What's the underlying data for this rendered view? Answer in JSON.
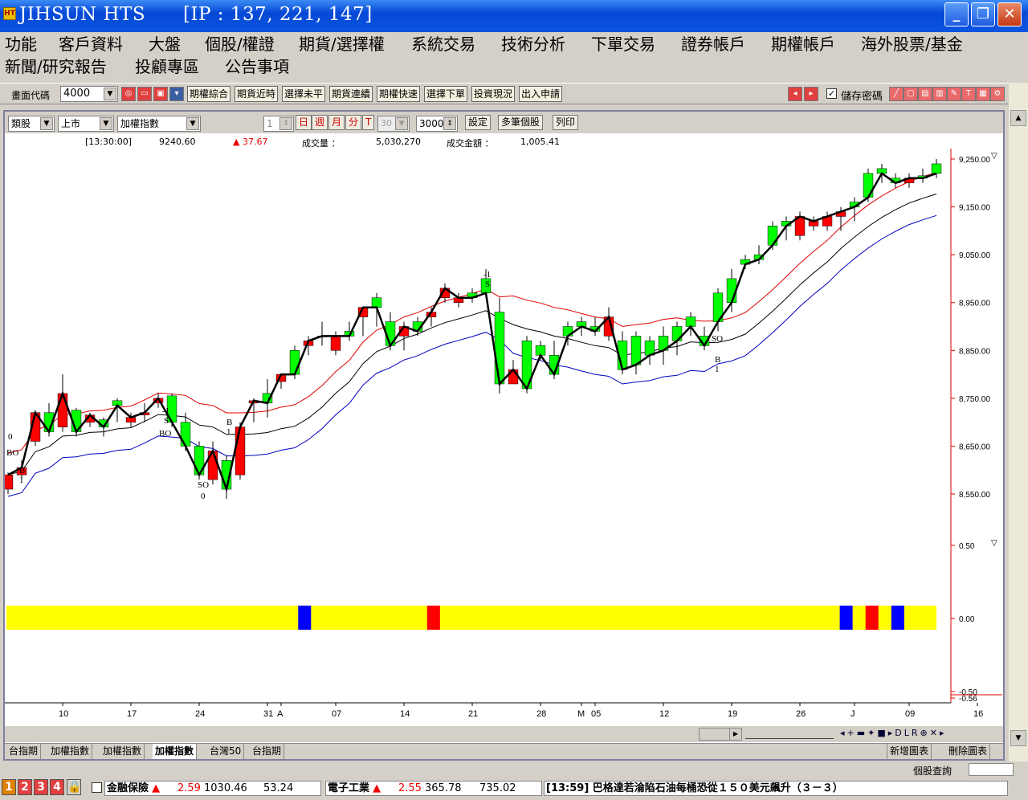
{
  "window": {
    "title": "JIHSUN HTS      [IP : 137, 221, 147]",
    "icon_text": "HT",
    "min": "_",
    "max": "❐",
    "close": "✕"
  },
  "menu": {
    "row1": [
      "功能",
      "客戶資料",
      "大盤",
      "個股/權證",
      "期貨/選擇權",
      "系統交易",
      "技術分析",
      "下單交易",
      "證券帳戶",
      "期權帳戶",
      "海外股票/基金"
    ],
    "row2": [
      "新聞/研究報告",
      "投顧專區",
      "公告事項"
    ]
  },
  "toolbar": {
    "code_label": "畫面代碼",
    "code_value": "4000",
    "funcs": [
      "期權綜合",
      "期貨近時",
      "選擇未平",
      "期貨連續",
      "期權快速",
      "選擇下單",
      "投資現況",
      "出入申請"
    ],
    "save_pwd": "儲存密碼"
  },
  "chart_toolbar": {
    "category": "類股",
    "market": "上市",
    "index": "加權指數",
    "n1": "1",
    "periods": [
      "日",
      "週",
      "月",
      "分",
      "T"
    ],
    "n2": "30",
    "count": "30000",
    "buttons": [
      "設定",
      "多筆個股",
      "列印"
    ]
  },
  "info": {
    "time": "[13:30:00]",
    "price": "9240.60",
    "change": "▲ 37.67",
    "vol_label": "成交量 ：",
    "vol": "5,030,270",
    "amt_label": "成交金額 ：",
    "amt": "1,005.41"
  },
  "chart_data": {
    "type": "candlestick",
    "ylim": [
      8500,
      9260
    ],
    "y_ticks": [
      "9,250.00",
      "9,150.00",
      "9,050.00",
      "8,950.00",
      "8,850.00",
      "8,750.00",
      "8,650.00",
      "8,550.00"
    ],
    "y_tick_values": [
      9250,
      9150,
      9050,
      8950,
      8850,
      8750,
      8650,
      8550
    ],
    "x_ticks": [
      "10",
      "17",
      "24",
      "31",
      "A",
      "07",
      "14",
      "21",
      "28",
      "M",
      "05",
      "12",
      "19",
      "26",
      "J",
      "09",
      "16"
    ],
    "x_tick_index": [
      4,
      9,
      14,
      19,
      20,
      24,
      29,
      34,
      39,
      42,
      43,
      48,
      53,
      58,
      62,
      66,
      71
    ],
    "candles": [
      [
        8560,
        8590,
        8550,
        8595
      ],
      [
        8590,
        8605,
        8580,
        8620
      ],
      [
        8660,
        8720,
        8650,
        8725
      ],
      [
        8720,
        8680,
        8670,
        8740
      ],
      [
        8690,
        8760,
        8680,
        8800
      ],
      [
        8725,
        8680,
        8670,
        8730
      ],
      [
        8700,
        8715,
        8690,
        8720
      ],
      [
        8705,
        8690,
        8670,
        8710
      ],
      [
        8745,
        8735,
        8700,
        8750
      ],
      [
        8700,
        8710,
        8690,
        8720
      ],
      [
        8715,
        8720,
        8700,
        8740
      ],
      [
        8740,
        8750,
        8730,
        8760
      ],
      [
        8755,
        8700,
        8690,
        8760
      ],
      [
        8700,
        8650,
        8640,
        8720
      ],
      [
        8650,
        8590,
        8580,
        8660
      ],
      [
        8580,
        8640,
        8570,
        8660
      ],
      [
        8620,
        8560,
        8540,
        8630
      ],
      [
        8590,
        8690,
        8580,
        8700
      ],
      [
        8740,
        8745,
        8700,
        8750
      ],
      [
        8760,
        8740,
        8710,
        8790
      ],
      [
        8785,
        8800,
        8770,
        8800
      ],
      [
        8850,
        8800,
        8790,
        8860
      ],
      [
        8860,
        8870,
        8840,
        8880
      ],
      [
        8880,
        8880,
        8860,
        8910
      ],
      [
        8850,
        8880,
        8840,
        8890
      ],
      [
        8890,
        8880,
        8870,
        8910
      ],
      [
        8920,
        8940,
        8880,
        8940
      ],
      [
        8960,
        8940,
        8900,
        8970
      ],
      [
        8910,
        8860,
        8850,
        8930
      ],
      [
        8880,
        8900,
        8850,
        8910
      ],
      [
        8910,
        8890,
        8880,
        8920
      ],
      [
        8920,
        8930,
        8900,
        8940
      ],
      [
        8960,
        8980,
        8950,
        8990
      ],
      [
        8950,
        8960,
        8940,
        8970
      ],
      [
        8970,
        8960,
        8950,
        8980
      ],
      [
        9000,
        8970,
        8960,
        9020
      ],
      [
        8930,
        8780,
        8760,
        8960
      ],
      [
        8780,
        8810,
        8790,
        8830
      ],
      [
        8870,
        8770,
        8760,
        8880
      ],
      [
        8860,
        8840,
        8830,
        8870
      ],
      [
        8840,
        8800,
        8790,
        8870
      ],
      [
        8900,
        8880,
        8860,
        8910
      ],
      [
        8910,
        8900,
        8880,
        8920
      ],
      [
        8900,
        8890,
        8880,
        8920
      ],
      [
        8880,
        8920,
        8870,
        8940
      ],
      [
        8870,
        8810,
        8800,
        8890
      ],
      [
        8880,
        8820,
        8800,
        8890
      ],
      [
        8870,
        8840,
        8820,
        8880
      ],
      [
        8880,
        8850,
        8820,
        8900
      ],
      [
        8900,
        8870,
        8840,
        8910
      ],
      [
        8920,
        8900,
        8880,
        8930
      ],
      [
        8880,
        8860,
        8850,
        8900
      ],
      [
        8970,
        8910,
        8890,
        8980
      ],
      [
        9000,
        8950,
        8930,
        9020
      ],
      [
        9040,
        9030,
        9020,
        9050
      ],
      [
        9050,
        9040,
        9030,
        9070
      ],
      [
        9110,
        9070,
        9060,
        9120
      ],
      [
        9120,
        9110,
        9080,
        9130
      ],
      [
        9090,
        9130,
        9080,
        9140
      ],
      [
        9110,
        9120,
        9100,
        9130
      ],
      [
        9110,
        9130,
        9100,
        9140
      ],
      [
        9130,
        9140,
        9100,
        9150
      ],
      [
        9160,
        9150,
        9120,
        9170
      ],
      [
        9220,
        9170,
        9160,
        9230
      ],
      [
        9230,
        9220,
        9200,
        9240
      ],
      [
        9210,
        9200,
        9190,
        9220
      ],
      [
        9200,
        9210,
        9190,
        9220
      ],
      [
        9215,
        9210,
        9200,
        9230
      ],
      [
        9240,
        9220,
        9210,
        9250
      ]
    ],
    "upper_band_color": "#e00000",
    "middle_color": "#000000",
    "lower_band_color": "#0000c0",
    "zigzag_color": "#000000",
    "signals": [
      "0",
      "BO",
      "B",
      "1",
      "-1",
      "S",
      "BO",
      "SO",
      "0",
      "B",
      "1",
      "-1",
      "S",
      "SO",
      "B",
      "1"
    ],
    "sub_y_ticks": [
      "0.50",
      "0.00",
      "-0.50",
      "-0.56"
    ],
    "sub_bar": {
      "bg": "#ffff00",
      "blue": [
        23,
        65,
        69
      ],
      "red": [
        33,
        67,
        109
      ]
    }
  },
  "tabs": [
    "台指期",
    "加權指數",
    "加權指數",
    "加權指數",
    "台灣50",
    "台指期"
  ],
  "tabs_right": [
    "新增圖表",
    "刪除圖表"
  ],
  "status": {
    "query": "個股查詢",
    "nums": [
      "1",
      "2",
      "3",
      "4"
    ],
    "q1_name": "金融保險",
    "q1_chg": "▲",
    "q1_v1": "2.59",
    "q1_v2": "1030.46",
    "q1_v3": "53.24",
    "q2_name": "電子工業",
    "q2_chg": "▲",
    "q2_v1": "2.55",
    "q2_v2": "365.78",
    "q2_v3": "735.02",
    "news": "[13:59] 巴格達若淪陷石油每桶恐從１５０美元飆升（３－３）"
  }
}
